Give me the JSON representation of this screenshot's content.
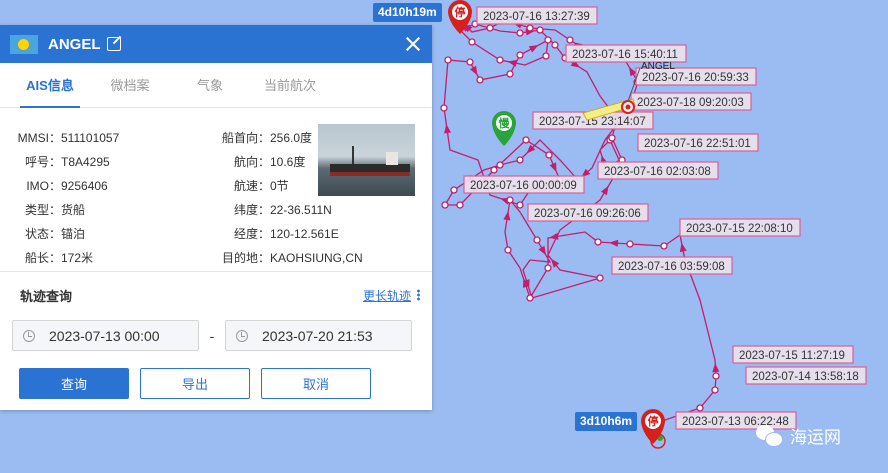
{
  "ship": {
    "name": "ANGEL",
    "tabs": [
      "AIS信息",
      "微档案",
      "气象",
      "当前航次"
    ],
    "fields": {
      "mmsi_label": "MMSI：",
      "mmsi": "511101057",
      "callsign_label": "呼号：",
      "callsign": "T8A4295",
      "imo_label": "IMO：",
      "imo": "9256406",
      "type_label": "类型：",
      "type": "货船",
      "status_label": "状态：",
      "status": "锚泊",
      "length_label": "船长：",
      "length": "172米",
      "heading_label": "船首向：",
      "heading": "256.0度",
      "course_label": "航向：",
      "course": "10.6度",
      "speed_label": "航速：",
      "speed": "0节",
      "lat_label": "纬度：",
      "lat": "22-36.511N",
      "lon_label": "经度：",
      "lon": "120-12.561E",
      "dest_label": "目的地：",
      "dest": "KAOHSIUNG,CN"
    }
  },
  "track": {
    "title": "轨迹查询",
    "more_label": "更长轨迹",
    "start": "2023-07-13 00:00",
    "dash": "-",
    "end": "2023-07-20 21:53",
    "query_label": "查询",
    "export_label": "导出",
    "cancel_label": "取消"
  },
  "map": {
    "route_color": "#c41d6e",
    "label_border": "#d8609a",
    "stop_top_duration": "4d10h19m",
    "stop_bottom_duration": "3d10h6m",
    "stop_marker_label": "停",
    "slow_marker_label": "慢",
    "ship_label": "ANGEL",
    "timestamps": [
      "2023-07-16 13:27:39",
      "2023-07-16 15:40:11",
      "2023-07-16 20:59:33",
      "2023-07-18 09:20:03",
      "2023-07-15 23:14:07",
      "2023-07-16 22:51:01",
      "2023-07-16 02:03:08",
      "2023-07-16 00:00:09",
      "2023-07-16 09:26:06",
      "2023-07-15 22:08:10",
      "2023-07-16 03:59:08",
      "2023-07-15 11:27:19",
      "2023-07-14 13:58:18",
      "2023-07-13 06:22:48"
    ],
    "watermark": "海运网"
  }
}
